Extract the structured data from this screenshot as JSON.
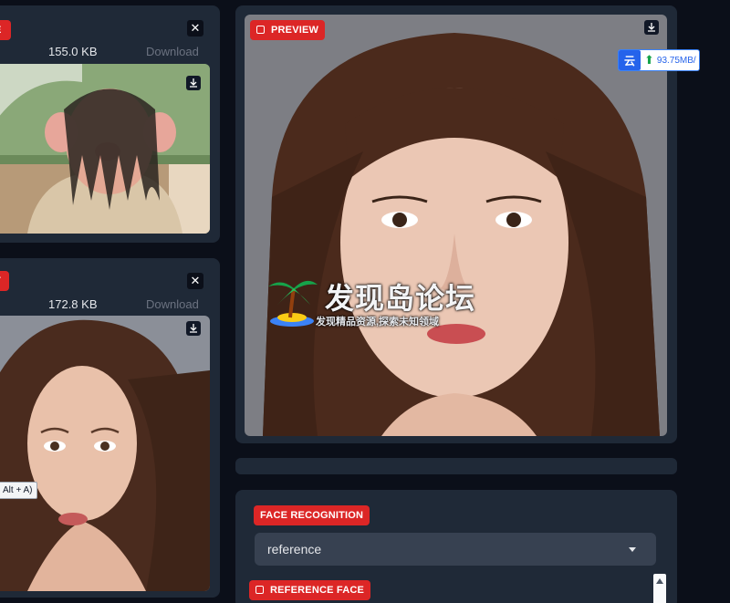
{
  "source_panel": {
    "size": "155.0 KB",
    "download_label": "Download",
    "close_glyph": "✕",
    "image": "pig-costume-character-photo"
  },
  "target_panel": {
    "size": "172.8 KB",
    "download_label": "Download",
    "close_glyph": "✕",
    "image": "woman-portrait-photo",
    "tooltip": "Alt + A)"
  },
  "preview_panel": {
    "label": "PREVIEW",
    "image": "face-swap-result"
  },
  "speed_widget": {
    "icon_glyph": "云",
    "arrow_glyph": "⬆",
    "value": "93.75MB/"
  },
  "watermark": {
    "title": "发现岛论坛",
    "subtitle": "发现精品资源,探索未知领域"
  },
  "face_recognition": {
    "label": "FACE RECOGNITION",
    "selected": "reference"
  },
  "reference_face": {
    "label": "REFERENCE FACE"
  },
  "colors": {
    "accent": "#dc2626",
    "panel": "#1f2937",
    "background": "#0b0f19",
    "input": "#374151"
  }
}
